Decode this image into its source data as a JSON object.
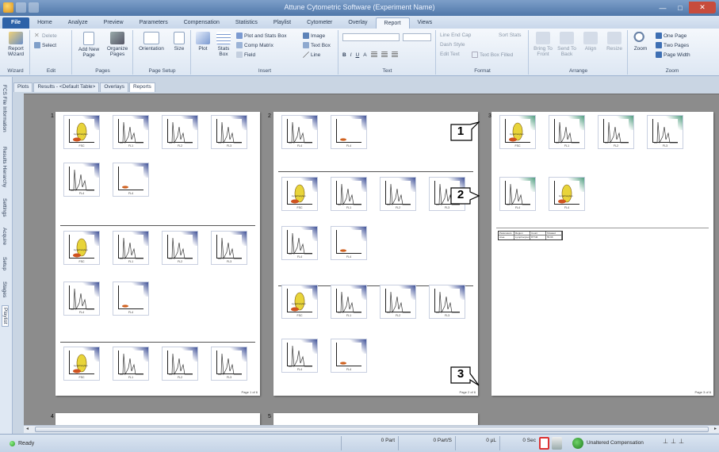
{
  "window": {
    "title": "Attune Cytometric Software (Experiment Name)",
    "controls": [
      "—",
      "□",
      "✕"
    ]
  },
  "tabs": [
    "File",
    "Home",
    "Analyze",
    "Preview",
    "Parameters",
    "Compensation",
    "Statistics",
    "Playlist",
    "Cytometer",
    "Overlay",
    "Report",
    "Views"
  ],
  "active_tab": "Report",
  "ribbon": {
    "wizard": {
      "button": "Report Wizard",
      "label": "Wizard"
    },
    "edit": {
      "delete": "Delete",
      "select": "Select",
      "label": "Edit"
    },
    "pages": {
      "add_new_page": "Add New Page",
      "organize_pages": "Organize Pages",
      "label": "Pages"
    },
    "page_setup": {
      "orientation": "Orientation",
      "size": "Size",
      "label": "Page Setup"
    },
    "insert": {
      "plot": "Plot",
      "stats_box": "Stats Box",
      "plot_and_stats_box": "Plot and Stats Box",
      "comp_matrix": "Comp Matrix",
      "field": "Field",
      "image": "Image",
      "text_box": "Text Box",
      "line": "Line",
      "label": "Insert"
    },
    "text": {
      "bold": "B",
      "italic": "I",
      "underline": "U",
      "font_color": "A",
      "label": "Text"
    },
    "format": {
      "line_end_cap": "Line End Cap",
      "dash_style": "Dash Style",
      "edit_text": "Edit Text",
      "text_box_filled": "Text Box Filled",
      "sort_stats": "Sort Stats",
      "label": "Format"
    },
    "arrange": {
      "bring_to_front": "Bring To Front",
      "send_to_back": "Send To Back",
      "align": "Align",
      "resize": "Resize",
      "label": "Arrange"
    },
    "zoom": {
      "zoom": "Zoom",
      "one_page": "One Page",
      "two_pages": "Two Pages",
      "page_width": "Page Width",
      "label": "Zoom"
    }
  },
  "sidebar_tabs": [
    "FCS File Information",
    "Results Hierarchy",
    "Settings",
    "Acquire",
    "Setup",
    "Stages",
    "Playlist"
  ],
  "document_tabs": [
    "Plots",
    "Results - <Default Table>",
    "Overlays",
    "Reports"
  ],
  "active_document_tab": "Reports",
  "pages": [
    {
      "number": "1",
      "footer": "Page 1 of 6"
    },
    {
      "number": "2",
      "footer": "Page 2 of 6"
    },
    {
      "number": "3",
      "footer": "Page 3 of 6"
    },
    {
      "number": "4"
    },
    {
      "number": "5"
    }
  ],
  "plot_labels": {
    "row_a": [
      "FSC",
      "FL1",
      "FL2",
      "FL3"
    ],
    "row_b": [
      "FL4",
      "FL4"
    ],
    "gate": "Lymphocytes"
  },
  "mini_table": {
    "header": [
      "Parameters",
      "Region",
      "Count",
      "%Gated"
    ],
    "row": [
      "Area",
      "Lymphocytes",
      "87746",
      "55.96"
    ]
  },
  "callouts": [
    "1",
    "2",
    "3"
  ],
  "status": {
    "ready": "Ready",
    "cells": [
      "0 Part",
      "0 Part/S",
      "0 µL",
      "0 Sec"
    ],
    "compensation": "Unaltered Compensation"
  },
  "colors": {
    "accent": "#2d62a8",
    "plot_corner": "#3d4f96",
    "plot_corner_selected": "#4f9d7f",
    "workspace": "#8c8c8c"
  }
}
